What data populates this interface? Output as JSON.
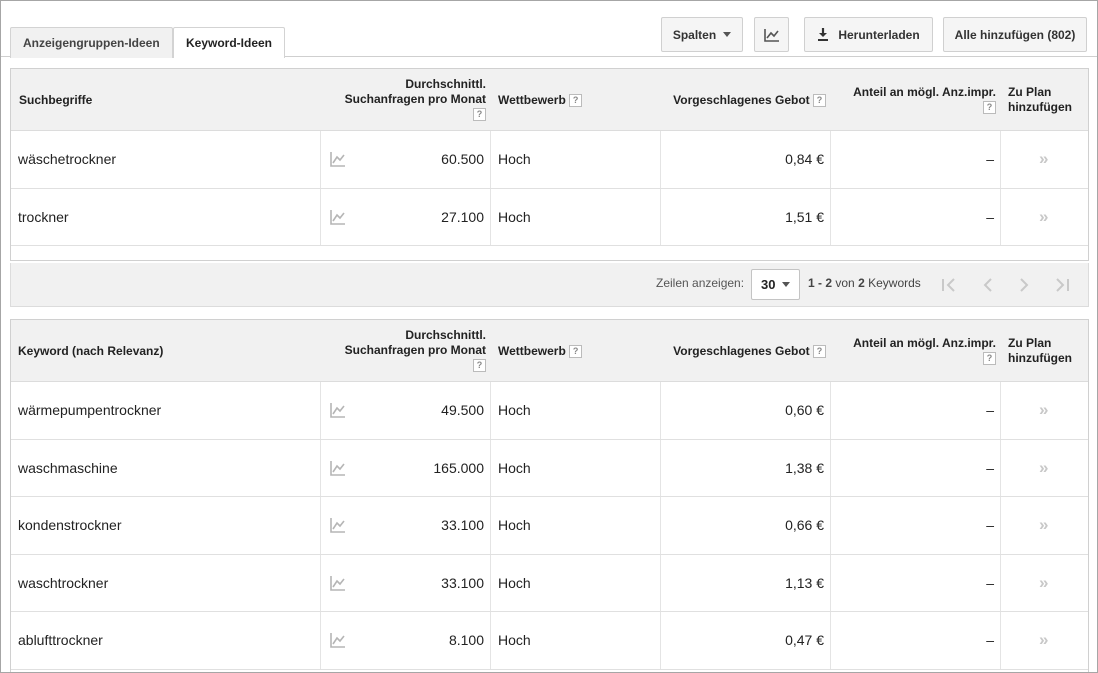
{
  "tabs": [
    {
      "label": "Anzeigengruppen-Ideen",
      "active": false
    },
    {
      "label": "Keyword-Ideen",
      "active": true
    }
  ],
  "toolbar": {
    "columns_label": "Spalten",
    "download_label": "Herunterladen",
    "add_all_label": "Alle hinzufügen (802)"
  },
  "colors": {
    "header_bg": "#f1f1f1",
    "border": "#d0d0d0",
    "muted_icon": "#b5b5b5"
  },
  "headers": {
    "search_volume_1": "Durchschnittl.",
    "search_volume_2": "Suchanfragen pro Monat",
    "competition": "Wettbewerb",
    "suggested_bid": "Vorgeschlagenes Gebot",
    "impr_share": "Anteil an mögl. Anz.impr.",
    "add_to_plan_1": "Zu Plan",
    "add_to_plan_2": "hinzufügen",
    "help": "?"
  },
  "search_terms_table": {
    "first_col_header": "Suchbegriffe",
    "rows": [
      {
        "keyword": "wäschetrockner",
        "volume": "60.500",
        "competition": "Hoch",
        "bid": "0,84 €",
        "impr": "–",
        "add": "»"
      },
      {
        "keyword": "trockner",
        "volume": "27.100",
        "competition": "Hoch",
        "bid": "1,51 €",
        "impr": "–",
        "add": "»"
      }
    ]
  },
  "pager": {
    "rows_label": "Zeilen anzeigen:",
    "rows_value": "30",
    "range": "1 - 2",
    "of_text": "von",
    "total": "2",
    "unit": "Keywords"
  },
  "keyword_table": {
    "first_col_header": "Keyword (nach Relevanz)",
    "rows": [
      {
        "keyword": "wärmepumpentrockner",
        "volume": "49.500",
        "competition": "Hoch",
        "bid": "0,60 €",
        "impr": "–",
        "add": "»"
      },
      {
        "keyword": "waschmaschine",
        "volume": "165.000",
        "competition": "Hoch",
        "bid": "1,38 €",
        "impr": "–",
        "add": "»"
      },
      {
        "keyword": "kondenstrockner",
        "volume": "33.100",
        "competition": "Hoch",
        "bid": "0,66 €",
        "impr": "–",
        "add": "»"
      },
      {
        "keyword": "waschtrockner",
        "volume": "33.100",
        "competition": "Hoch",
        "bid": "1,13 €",
        "impr": "–",
        "add": "»"
      },
      {
        "keyword": "ablufttrockner",
        "volume": "8.100",
        "competition": "Hoch",
        "bid": "0,47 €",
        "impr": "–",
        "add": "»"
      }
    ]
  }
}
